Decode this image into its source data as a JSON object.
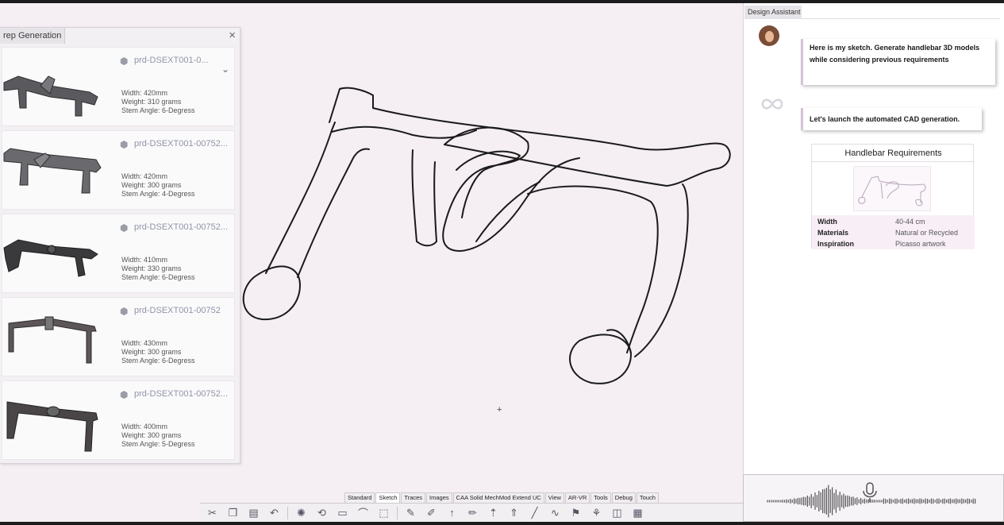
{
  "generation_panel": {
    "title": "rep Generation",
    "close_icon": "close-icon",
    "items": [
      {
        "id": "prd-DSEXT001-0...",
        "width": "Width: 420mm",
        "weight": "Weight: 310 grams",
        "stem": "Stem Angle: 6-Degress",
        "expand_icon": "chevron-down-icon"
      },
      {
        "id": "prd-DSEXT001-00752...",
        "width": "Width: 420mm",
        "weight": "Weight: 300 grams",
        "stem": "Stem Angle: 4-Degress"
      },
      {
        "id": "prd-DSEXT001-00752...",
        "width": "Width: 410mm",
        "weight": "Weight: 330 grams",
        "stem": "Stem Angle: 6-Degress"
      },
      {
        "id": "prd-DSEXT001-00752",
        "width": "Width: 430mm",
        "weight": "Weight: 300 grams",
        "stem": "Stem Angle: 6-Degress"
      },
      {
        "id": "prd-DSEXT001-00752...",
        "width": "Width: 400mm",
        "weight": "Weight: 300 grams",
        "stem": "Stem Angle: 5-Degress"
      }
    ]
  },
  "assistant": {
    "tab_label": "Design Assistant",
    "user_message": "Here is my sketch. Generate handlebar 3D models while considering previous requirements",
    "assistant_message": "Let's launch the automated CAD generation.",
    "requirements": {
      "title": "Handlebar  Requirements",
      "rows": [
        {
          "key": "Width",
          "value": "40-44 cm"
        },
        {
          "key": "Materials",
          "value": "Natural or Recycled"
        },
        {
          "key": "Inspiration",
          "value": "Picasso artwork"
        }
      ]
    },
    "voice_icon": "microphone-icon"
  },
  "toolbar": {
    "tabs": [
      "Standard",
      "Sketch",
      "Traces",
      "Images",
      "CAA Solid MechMod Extend UC",
      "View",
      "AR-VR",
      "Tools",
      "Debug",
      "Touch"
    ],
    "active_tab": "Sketch",
    "tools": [
      "scissors-icon",
      "copy-icon",
      "paste-icon",
      "undo-icon",
      "settings-icon",
      "transform-icon",
      "page-icon",
      "curve-icon",
      "select-icon",
      "pen-icon",
      "brush-icon",
      "arrow-icon",
      "pencil-icon",
      "arrow-icon",
      "arrow-icon",
      "line-icon",
      "wave-icon",
      "stamp-icon",
      "network-icon",
      "layers-icon",
      "chart-icon"
    ]
  }
}
